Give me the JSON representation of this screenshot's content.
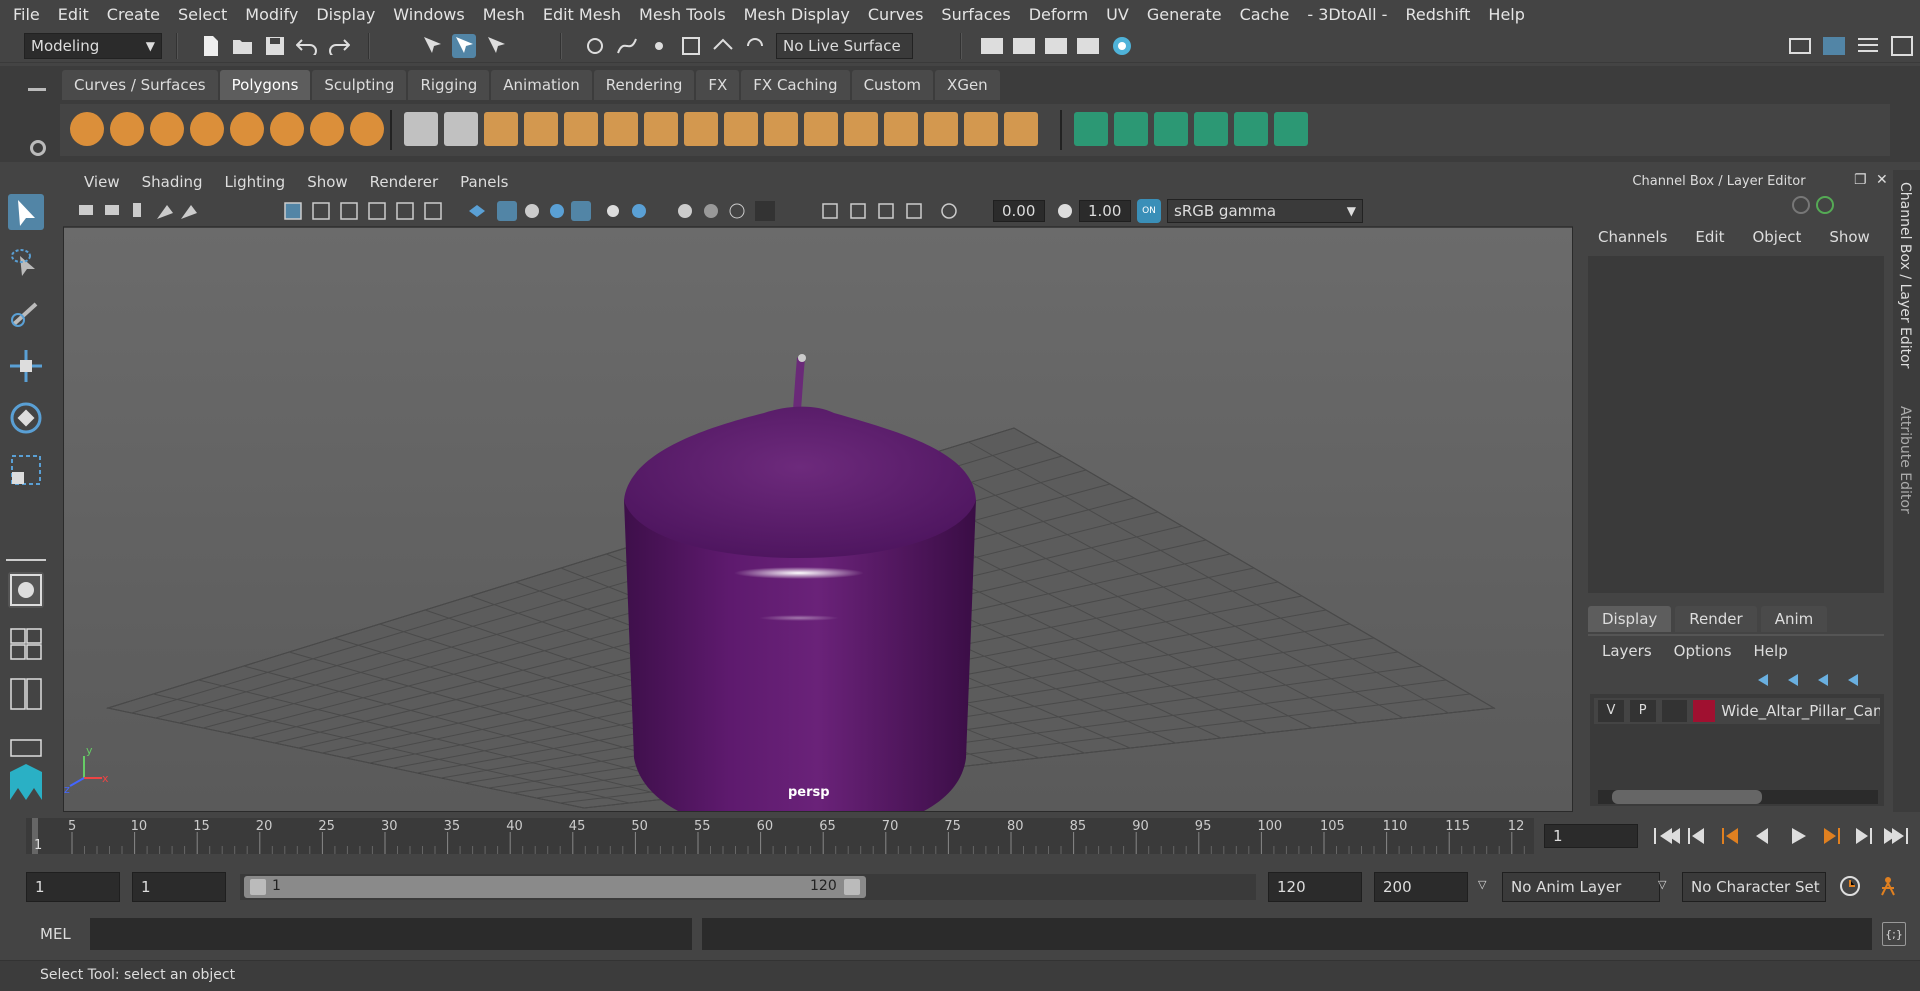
{
  "menubar": [
    "File",
    "Edit",
    "Create",
    "Select",
    "Modify",
    "Display",
    "Windows",
    "Mesh",
    "Edit Mesh",
    "Mesh Tools",
    "Mesh Display",
    "Curves",
    "Surfaces",
    "Deform",
    "UV",
    "Generate",
    "Cache",
    "- 3DtoAll -",
    "Redshift",
    "Help"
  ],
  "status": {
    "mode": "Modeling",
    "live_surface": "No Live Surface"
  },
  "shelf": {
    "tabs": [
      "Curves / Surfaces",
      "Polygons",
      "Sculpting",
      "Rigging",
      "Animation",
      "Rendering",
      "FX",
      "FX Caching",
      "Custom",
      "XGen"
    ],
    "active": "Polygons"
  },
  "viewport": {
    "menu": [
      "View",
      "Shading",
      "Lighting",
      "Show",
      "Renderer",
      "Panels"
    ],
    "exposure": "0.00",
    "gamma": "1.00",
    "colorspace": "sRGB gamma",
    "camera_label": "persp"
  },
  "channelbox": {
    "title": "Channel Box / Layer Editor",
    "menu": [
      "Channels",
      "Edit",
      "Object",
      "Show"
    ],
    "layer_tabs": [
      "Display",
      "Render",
      "Anim"
    ],
    "layer_menu": [
      "Layers",
      "Options",
      "Help"
    ],
    "layer": {
      "v": "V",
      "p": "P",
      "name": "Wide_Altar_Pillar_Candle",
      "color": "#a01030"
    }
  },
  "sidetabs": [
    "Channel Box / Layer Editor",
    "Attribute Editor"
  ],
  "timeline": {
    "ticks": [
      "5",
      "10",
      "15",
      "20",
      "25",
      "30",
      "35",
      "40",
      "45",
      "50",
      "55",
      "60",
      "65",
      "70",
      "75",
      "80",
      "85",
      "90",
      "95",
      "100",
      "105",
      "110",
      "115",
      "12"
    ],
    "current_marker": "1",
    "current_frame": "1"
  },
  "range": {
    "start": "1",
    "play_start": "1",
    "slider_start": "1",
    "slider_end": "120",
    "play_end": "120",
    "end": "200",
    "anim_layer": "No Anim Layer",
    "char_set": "No Character Set"
  },
  "cmd": {
    "label": "MEL"
  },
  "help": {
    "text": "Select Tool: select an object"
  },
  "colors": {
    "candle": "#5e1a6e",
    "accent": "#5a9bd5",
    "active_layer": "#a01030"
  }
}
